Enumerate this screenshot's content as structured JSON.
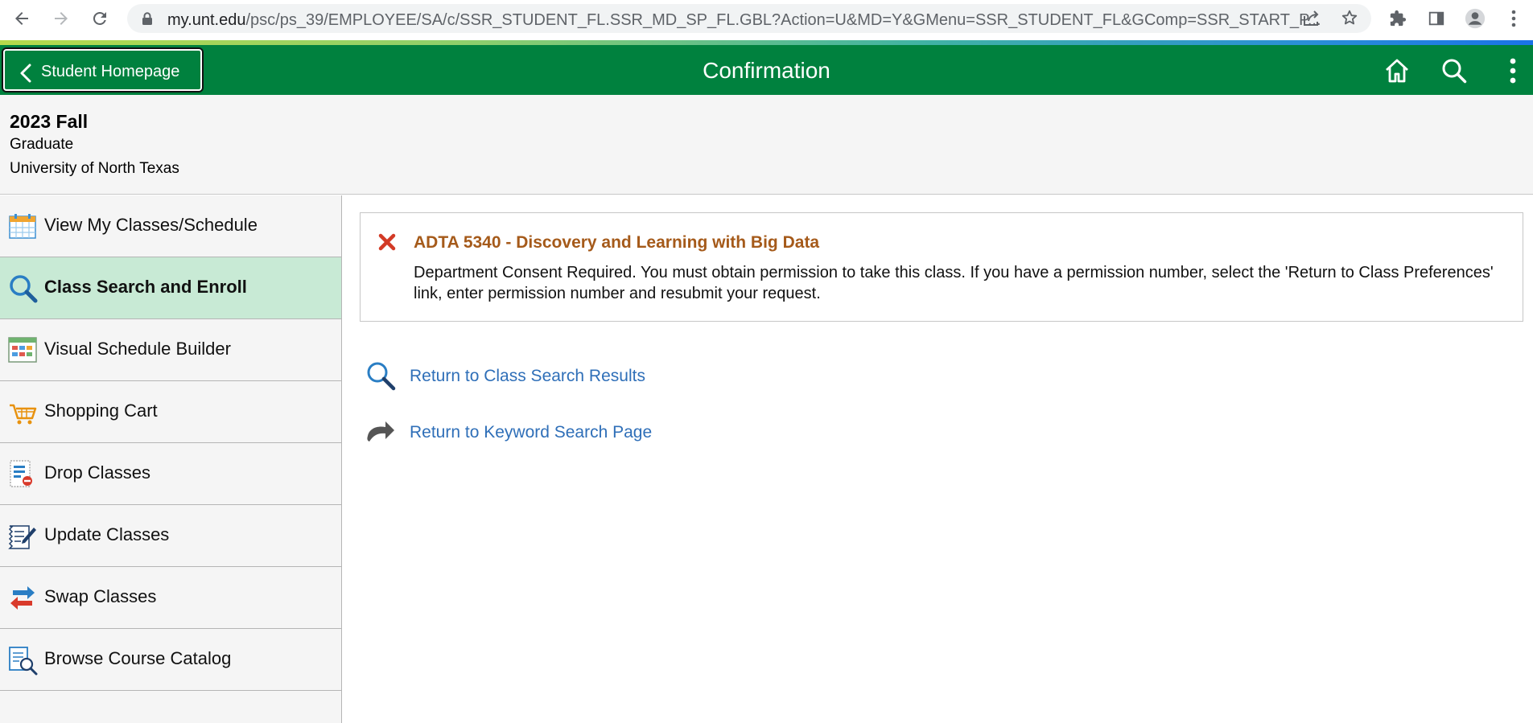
{
  "browser": {
    "url_host": "my.unt.edu",
    "url_path": "/psc/ps_39/EMPLOYEE/SA/c/SSR_STUDENT_FL.SSR_MD_SP_FL.GBL?Action=U&MD=Y&GMenu=SSR_STUDENT_FL&GComp=SSR_START_P..."
  },
  "header": {
    "back_label": "Student Homepage",
    "title": "Confirmation",
    "color": "#00813e"
  },
  "term": {
    "name": "2023 Fall",
    "career": "Graduate",
    "institution": "University of North Texas"
  },
  "sidebar": {
    "items": [
      {
        "label": "View My Classes/Schedule",
        "icon": "calendar-icon"
      },
      {
        "label": "Class Search and Enroll",
        "icon": "search-icon",
        "active": true
      },
      {
        "label": "Visual Schedule Builder",
        "icon": "schedule-builder-icon"
      },
      {
        "label": "Shopping Cart",
        "icon": "cart-icon"
      },
      {
        "label": "Drop Classes",
        "icon": "drop-icon"
      },
      {
        "label": "Update Classes",
        "icon": "edit-icon"
      },
      {
        "label": "Swap Classes",
        "icon": "swap-icon"
      },
      {
        "label": "Browse Course Catalog",
        "icon": "catalog-icon"
      }
    ],
    "active_color": "#c8ead5"
  },
  "message": {
    "title": "ADTA 5340 - Discovery and Learning with Big Data",
    "text": "Department Consent Required. You must obtain permission to take this class. If you have a permission number, select the 'Return to Class Preferences' link, enter permission number and resubmit your request.",
    "status": "error",
    "title_color": "#a55a1a"
  },
  "links": {
    "search_results": "Return to Class Search Results",
    "keyword_search": "Return to Keyword Search Page",
    "color": "#2f6fb8"
  }
}
